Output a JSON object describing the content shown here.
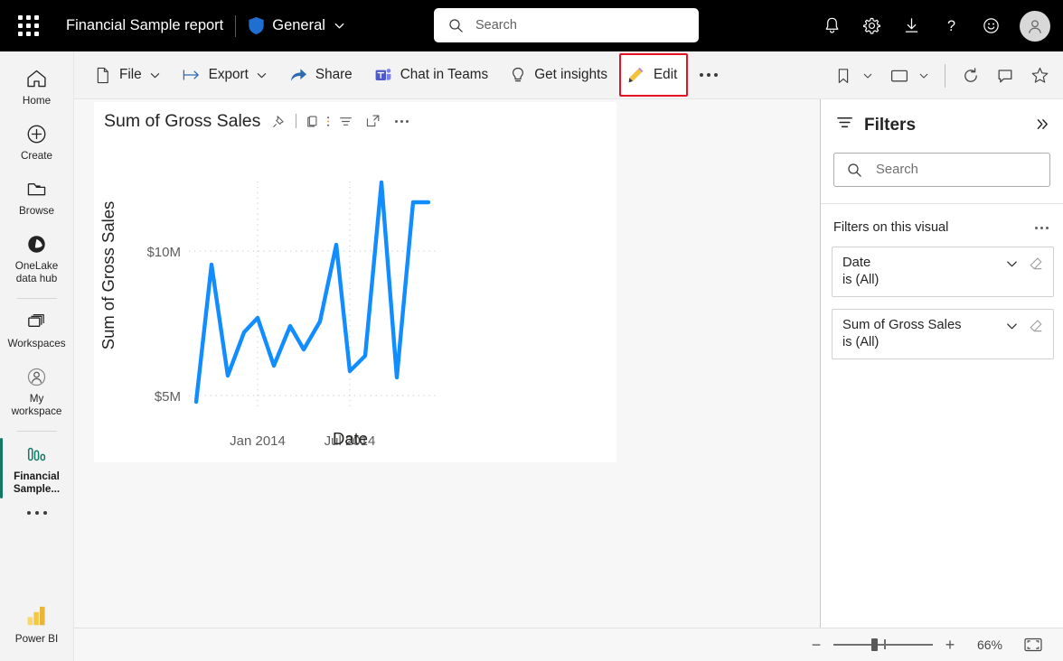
{
  "header": {
    "app_launcher": "waffle-grid-icon",
    "report_title": "Financial Sample report",
    "workspace_name": "General",
    "workspace_icon": "shield-icon",
    "search": {
      "placeholder": "Search"
    },
    "actions": [
      {
        "name": "notifications",
        "icon": "bell-icon"
      },
      {
        "name": "settings",
        "icon": "gear-icon"
      },
      {
        "name": "downloads",
        "icon": "download-icon"
      },
      {
        "name": "help",
        "icon": "question-mark-icon"
      },
      {
        "name": "feedback",
        "icon": "smiley-icon"
      }
    ],
    "avatar": "user-avatar-icon"
  },
  "sidebar": {
    "items": [
      {
        "label": "Home",
        "icon": "home-icon",
        "selected": false
      },
      {
        "label": "Create",
        "icon": "plus-circle-icon",
        "selected": false
      },
      {
        "label": "Browse",
        "icon": "folder-icon",
        "selected": false
      },
      {
        "label": "OneLake\ndata hub",
        "icon": "onelake-icon",
        "selected": false
      },
      {
        "label": "Workspaces",
        "icon": "workspaces-icon",
        "selected": false
      },
      {
        "label": "My\nworkspace",
        "icon": "my-workspace-icon",
        "selected": false
      },
      {
        "label": "Financial Sample...",
        "icon": "report-bars-icon",
        "selected": true
      }
    ],
    "more": "more-dots",
    "footer": {
      "label": "Power BI",
      "icon": "power-bi-logo"
    }
  },
  "toolbar": {
    "items": [
      {
        "label": "File",
        "icon": "file-icon",
        "has_chevron": true
      },
      {
        "label": "Export",
        "icon": "export-icon",
        "has_chevron": true
      },
      {
        "label": "Share",
        "icon": "share-icon",
        "has_chevron": false
      },
      {
        "label": "Chat in Teams",
        "icon": "teams-icon",
        "has_chevron": false
      },
      {
        "label": "Get insights",
        "icon": "lightbulb-icon",
        "has_chevron": false
      }
    ],
    "edit": {
      "label": "Edit",
      "icon": "pencil-icon",
      "highlighted": true,
      "highlight_color": "#e81123"
    },
    "overflow": "more-dots",
    "right_icons": [
      {
        "name": "bookmarks",
        "icon": "bookmark-icon",
        "has_chevron": true
      },
      {
        "name": "view",
        "icon": "screen-icon",
        "has_chevron": true
      },
      {
        "name": "refresh",
        "icon": "refresh-icon",
        "has_chevron": false
      },
      {
        "name": "comments",
        "icon": "comment-icon",
        "has_chevron": false
      },
      {
        "name": "favorite",
        "icon": "star-icon",
        "has_chevron": false
      }
    ]
  },
  "visual": {
    "title": "Sum of Gross Sales",
    "header_icons": [
      {
        "name": "pin-visual",
        "icon": "pin-icon"
      },
      {
        "name": "copy-visual",
        "icon": "copy-icon"
      },
      {
        "name": "filter-visual",
        "icon": "filter-icon"
      },
      {
        "name": "focus-mode",
        "icon": "focus-expand-icon"
      },
      {
        "name": "more-options",
        "icon": "more-dots-icon"
      }
    ]
  },
  "chart_data": {
    "type": "line",
    "title": "Sum of Gross Sales",
    "xlabel": "Date",
    "ylabel": "Sum of Gross Sales",
    "ytick_labels": [
      "$5M",
      "$10M"
    ],
    "ytick_values": [
      5000000,
      10000000
    ],
    "ylim": [
      4200000,
      13400000
    ],
    "xtick_labels": [
      "Jan 2014",
      "Jul 2014"
    ],
    "grid": true,
    "legend": "none",
    "line_color": "#118DFF",
    "series": [
      {
        "name": "Sum of Gross Sales",
        "x": [
          "Sep 2013",
          "Oct 2013",
          "Nov 2013",
          "Dec 2013",
          "Jan 2014",
          "Feb 2014",
          "Mar 2014",
          "Apr 2014",
          "May 2014",
          "Jun 2014",
          "Jul 2014",
          "Aug 2014",
          "Sep 2014",
          "Oct 2014",
          "Nov 2014",
          "Dec 2014"
        ],
        "values": [
          4700000,
          9900000,
          6000000,
          7500000,
          8000000,
          6400000,
          7700000,
          6900000,
          7900000,
          10400000,
          6500000,
          7000000,
          13300000,
          6200000,
          12600000,
          12600000
        ]
      }
    ]
  },
  "filters": {
    "title": "Filters",
    "title_icon": "filter-icon",
    "expand_icon": "double-chevron-right-icon",
    "search": {
      "placeholder": "Search",
      "icon": "search-icon"
    },
    "section_label": "Filters on this visual",
    "section_more": "more-dots",
    "cards": [
      {
        "name": "Date",
        "value": "is (All)",
        "chevron": "chevron-down-icon",
        "clear": "eraser-icon"
      },
      {
        "name": "Sum of Gross Sales",
        "value": "is (All)",
        "chevron": "chevron-down-icon",
        "clear": "eraser-icon"
      }
    ]
  },
  "statusbar": {
    "zoom_out": "−",
    "zoom_in": "+",
    "zoom_level": "66%",
    "fit_to_page": "fit-to-page-icon"
  }
}
